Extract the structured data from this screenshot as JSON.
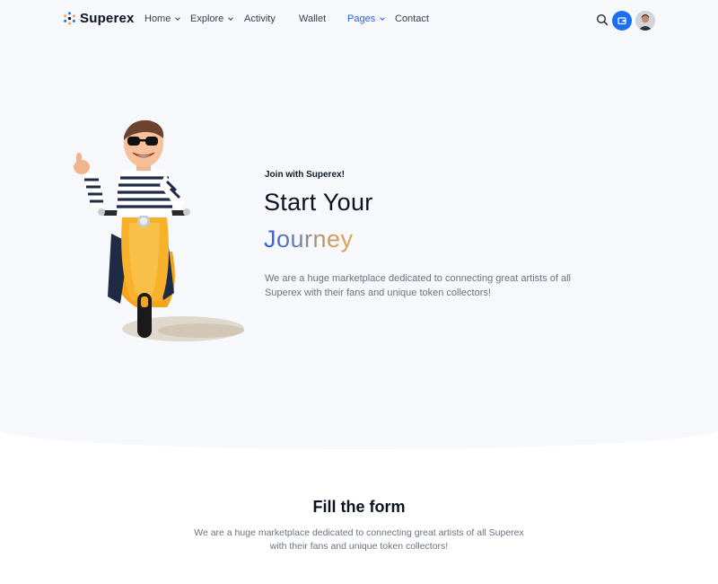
{
  "brand": {
    "name": "Superex"
  },
  "nav": {
    "items": [
      {
        "label": "Home",
        "dropdown": true,
        "active": false
      },
      {
        "label": "Explore",
        "dropdown": true,
        "active": false
      },
      {
        "label": "Activity",
        "dropdown": false,
        "active": false
      },
      {
        "label": "Wallet",
        "dropdown": false,
        "active": false
      },
      {
        "label": "Pages",
        "dropdown": true,
        "active": true
      },
      {
        "label": "Contact",
        "dropdown": false,
        "active": false
      }
    ]
  },
  "header_actions": {
    "search_icon": "search-icon",
    "wallet_icon": "wallet-icon",
    "avatar_icon": "user-avatar"
  },
  "hero": {
    "kicker": "Join with Superex!",
    "title": "Start Your",
    "accent": "Journey",
    "description": "We are a huge marketplace dedicated to connecting great artists of all Superex with their fans and unique token collectors!"
  },
  "form_section": {
    "title": "Fill the form",
    "description": "We are a huge marketplace dedicated to connecting great artists of all Superex with their fans and unique token collectors!"
  },
  "colors": {
    "accent": "#1d6ff2",
    "nav_active": "#2563eb",
    "hero_background": "#f6f8fc"
  }
}
